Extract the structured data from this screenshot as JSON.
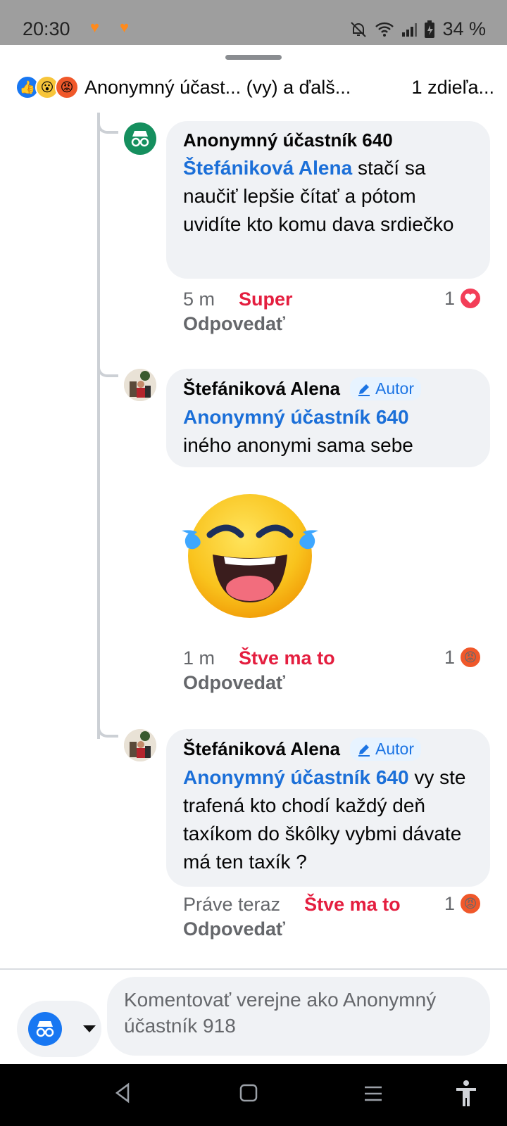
{
  "status_bar": {
    "time": "20:30",
    "battery": "34 %"
  },
  "header": {
    "title": "Anonymný účast... (vy) a ďalš...",
    "shares": "1 zdieľa..."
  },
  "comments": [
    {
      "author": "Anonymný účastník 640",
      "mention": "Štefániková Alena",
      "text": " stačí sa naučiť lepšie čítať a pótom uvidíte kto komu dava srdiečko",
      "time": "5 m",
      "reaction_label": "Super",
      "reaction_count": "1",
      "reply": "Odpovedať"
    },
    {
      "author": "Štefániková Alena",
      "badge": "Autor",
      "mention": "Anonymný účastník 640",
      "text": "iného anonymi sama sebe",
      "time": "1 m",
      "reaction_label": "Štve ma to",
      "reaction_count": "1",
      "reply": "Odpovedať"
    },
    {
      "author": "Štefániková Alena",
      "badge": "Autor",
      "mention": "Anonymný účastník 640",
      "text": " vy ste trafená kto chodí každý deň taxíkom do škôlky vybmi dávate má ten taxík ?",
      "time": "Práve teraz",
      "reaction_label": "Štve ma to",
      "reaction_count": "1",
      "reply": "Odpovedať"
    }
  ],
  "composer": {
    "placeholder": "Komentovať verejne ako Anonymný účastník 918"
  },
  "colors": {
    "link": "#1b6fd8",
    "reaction_red": "#e41e3f",
    "bubble": "#f0f2f5"
  }
}
